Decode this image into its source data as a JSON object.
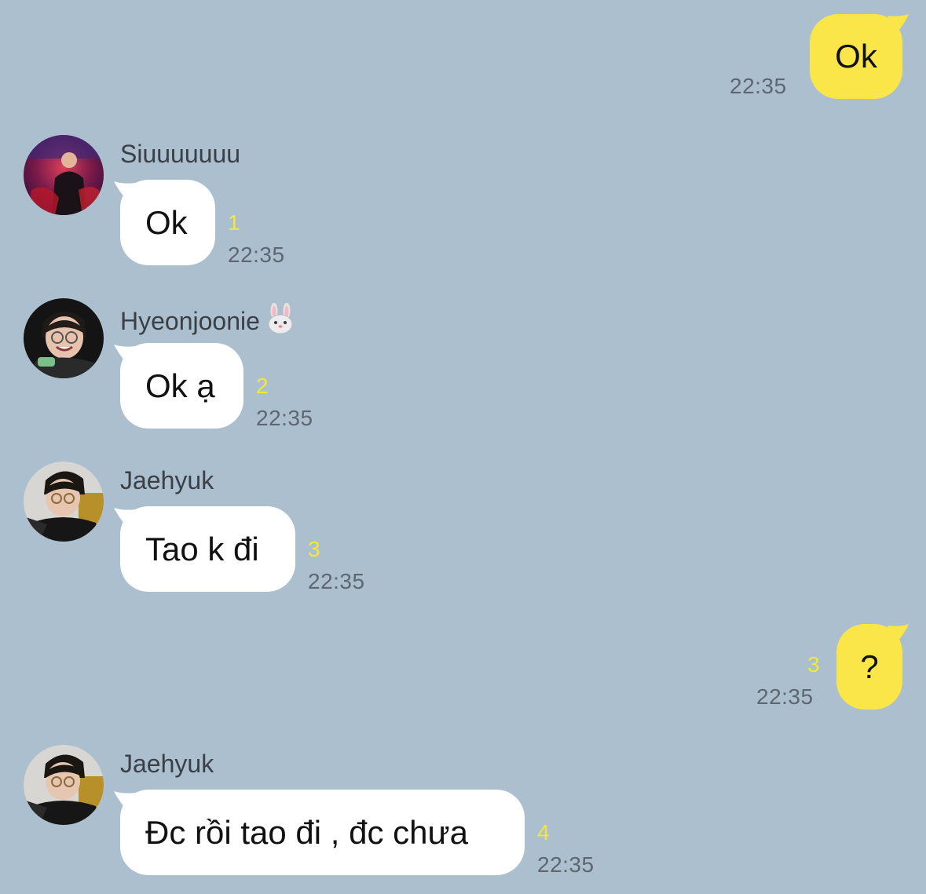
{
  "colors": {
    "background": "#abbfce",
    "bubble_incoming": "#ffffff",
    "bubble_outgoing": "#fbe64a",
    "unread_count": "#f7e63a",
    "timestamp": "#5d6671"
  },
  "messages": [
    {
      "direction": "outgoing",
      "text": "Ok",
      "time": "22:35",
      "unread": ""
    },
    {
      "direction": "incoming",
      "sender": "Siuuuuuuu",
      "avatar": "avatar-siuuuuuuu",
      "text": "Ok",
      "unread": "1",
      "time": "22:35"
    },
    {
      "direction": "incoming",
      "sender": "Hyeonjoonie",
      "sender_emoji": "rabbit-face-icon",
      "avatar": "avatar-hyeonjoonie",
      "text": "Ok ạ",
      "unread": "2",
      "time": "22:35"
    },
    {
      "direction": "incoming",
      "sender": "Jaehyuk",
      "avatar": "avatar-jaehyuk",
      "text": "Tao k đi",
      "unread": "3",
      "time": "22:35"
    },
    {
      "direction": "outgoing",
      "text": "?",
      "unread": "3",
      "time": "22:35"
    },
    {
      "direction": "incoming",
      "sender": "Jaehyuk",
      "avatar": "avatar-jaehyuk",
      "text": "Đc rồi tao đi , đc chưa",
      "unread": "4",
      "time": "22:35"
    }
  ]
}
